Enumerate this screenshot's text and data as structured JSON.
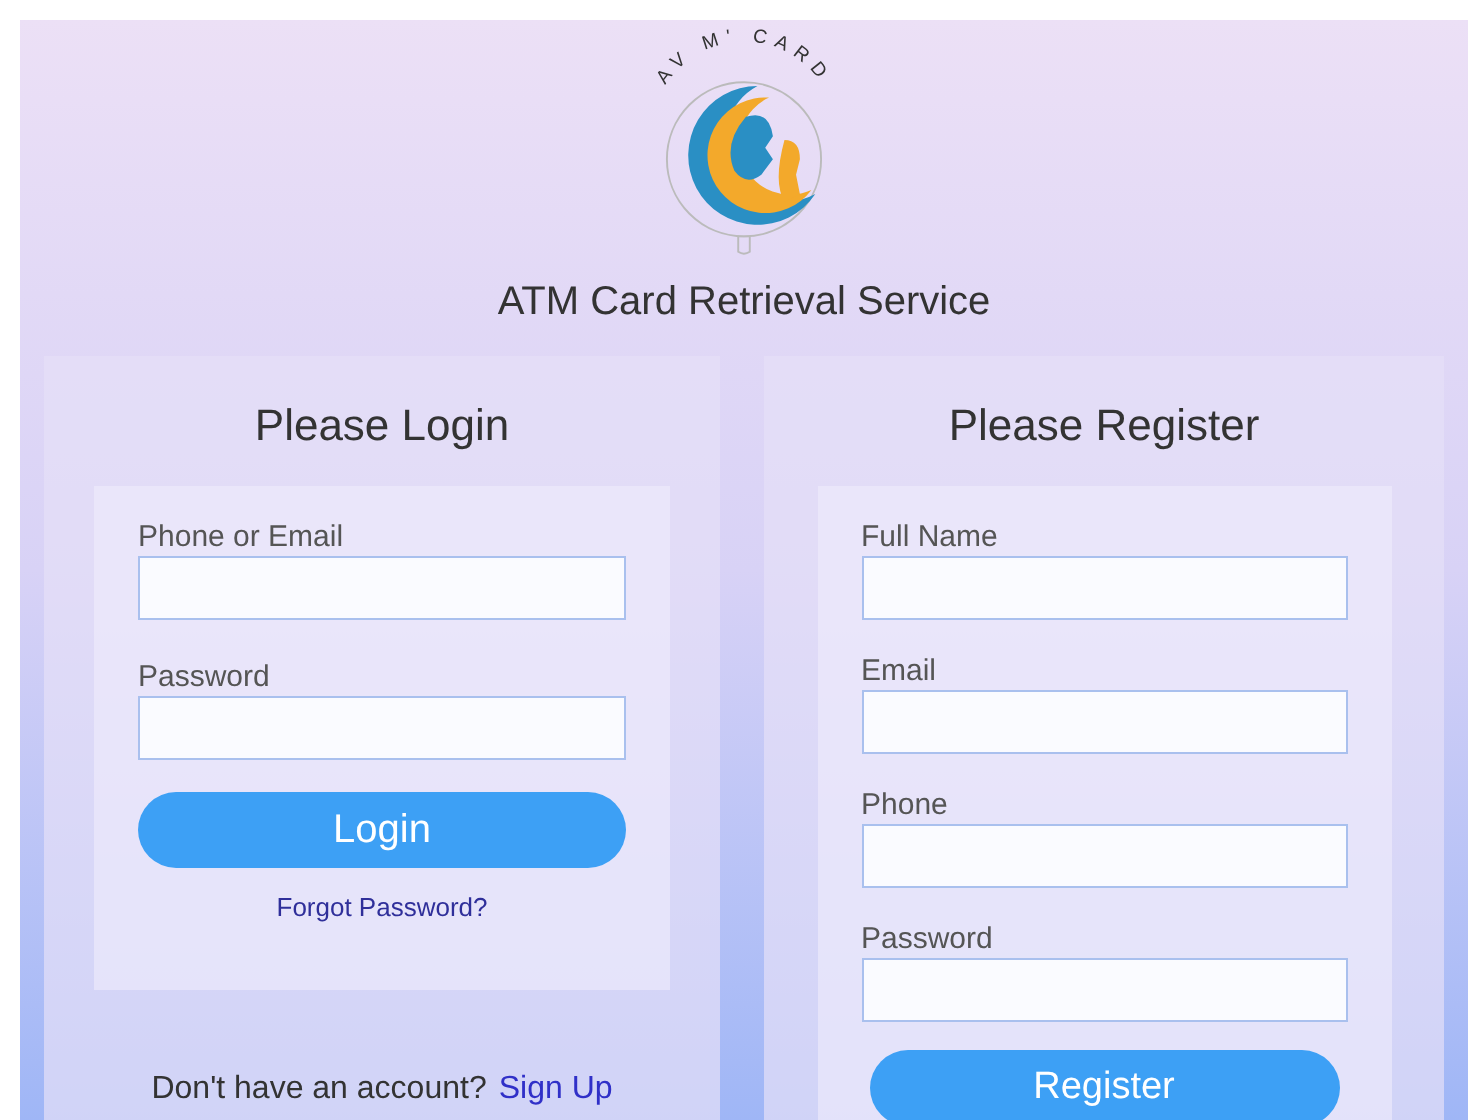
{
  "logo": {
    "text": "AV M' CARD"
  },
  "title": "ATM Card Retrieval Service",
  "login": {
    "heading": "Please Login",
    "fields": [
      {
        "label": "Phone or Email"
      },
      {
        "label": "Password"
      }
    ],
    "button": "Login",
    "forgot_link": "Forgot Password?",
    "signup_prompt": "Don't have an account?",
    "signup_link": "Sign Up"
  },
  "register": {
    "heading": "Please Register",
    "fields": [
      {
        "label": "Full Name"
      },
      {
        "label": "Email"
      },
      {
        "label": "Phone"
      },
      {
        "label": "Password"
      }
    ],
    "button": "Register"
  }
}
